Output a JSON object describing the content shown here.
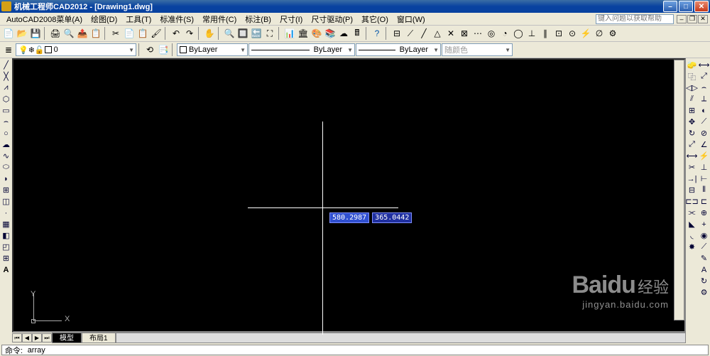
{
  "title": "机械工程师CAD2012 - [Drawing1.dwg]",
  "menu": {
    "items": [
      "AutoCAD2008菜单(A)",
      "绘图(D)",
      "工具(T)",
      "标准件(S)",
      "常用件(C)",
      "标注(B)",
      "尺寸(I)",
      "尺寸驱动(P)",
      "其它(O)",
      "窗口(W)"
    ]
  },
  "help_placeholder": "键入问题以获取帮助",
  "layers": {
    "current": "0",
    "bylayer": "ByLayer",
    "color_label": "随颜色"
  },
  "cursor": {
    "val1": "580.2987",
    "val2": "365.0442"
  },
  "ucs": {
    "x": "X",
    "y": "Y"
  },
  "tabs": {
    "model": "模型",
    "layout1": "布局1"
  },
  "command": {
    "prompt": "命令:",
    "text": "array"
  },
  "watermark": {
    "brand": "Baidu",
    "cn": "经验",
    "url": "jingyan.baidu.com"
  }
}
